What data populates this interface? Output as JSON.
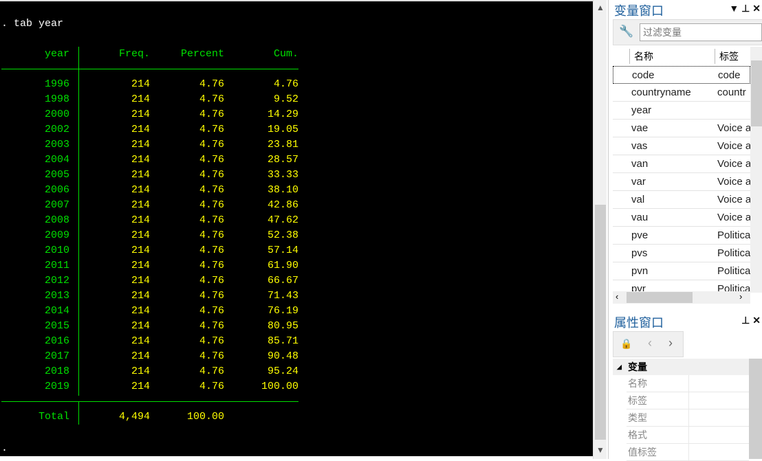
{
  "results": {
    "command": ". tab year",
    "headers": [
      "year",
      "Freq.",
      "Percent",
      "Cum."
    ],
    "rows": [
      [
        "1996",
        "214",
        "4.76",
        "4.76"
      ],
      [
        "1998",
        "214",
        "4.76",
        "9.52"
      ],
      [
        "2000",
        "214",
        "4.76",
        "14.29"
      ],
      [
        "2002",
        "214",
        "4.76",
        "19.05"
      ],
      [
        "2003",
        "214",
        "4.76",
        "23.81"
      ],
      [
        "2004",
        "214",
        "4.76",
        "28.57"
      ],
      [
        "2005",
        "214",
        "4.76",
        "33.33"
      ],
      [
        "2006",
        "214",
        "4.76",
        "38.10"
      ],
      [
        "2007",
        "214",
        "4.76",
        "42.86"
      ],
      [
        "2008",
        "214",
        "4.76",
        "47.62"
      ],
      [
        "2009",
        "214",
        "4.76",
        "52.38"
      ],
      [
        "2010",
        "214",
        "4.76",
        "57.14"
      ],
      [
        "2011",
        "214",
        "4.76",
        "61.90"
      ],
      [
        "2012",
        "214",
        "4.76",
        "66.67"
      ],
      [
        "2013",
        "214",
        "4.76",
        "71.43"
      ],
      [
        "2014",
        "214",
        "4.76",
        "76.19"
      ],
      [
        "2015",
        "214",
        "4.76",
        "80.95"
      ],
      [
        "2016",
        "214",
        "4.76",
        "85.71"
      ],
      [
        "2017",
        "214",
        "4.76",
        "90.48"
      ],
      [
        "2018",
        "214",
        "4.76",
        "95.24"
      ],
      [
        "2019",
        "214",
        "4.76",
        "100.00"
      ]
    ],
    "total": {
      "label": "Total",
      "freq": "4,494",
      "percent": "100.00"
    },
    "prompt": "."
  },
  "variables": {
    "title": "变量窗口",
    "filter_placeholder": "过滤变量",
    "col_name": "名称",
    "col_label": "标签",
    "rows": [
      {
        "name": "code",
        "label": "code"
      },
      {
        "name": "countryname",
        "label": "countr"
      },
      {
        "name": "year",
        "label": ""
      },
      {
        "name": "vae",
        "label": "Voice a"
      },
      {
        "name": "vas",
        "label": "Voice a"
      },
      {
        "name": "van",
        "label": "Voice a"
      },
      {
        "name": "var",
        "label": "Voice a"
      },
      {
        "name": "val",
        "label": "Voice a"
      },
      {
        "name": "vau",
        "label": "Voice a"
      },
      {
        "name": "pve",
        "label": "Politica"
      },
      {
        "name": "pvs",
        "label": "Politica"
      },
      {
        "name": "pvn",
        "label": "Politica"
      },
      {
        "name": "pvr",
        "label": "Politica"
      }
    ]
  },
  "properties": {
    "title": "属性窗口",
    "section": "变量",
    "fields": [
      "名称",
      "标签",
      "类型",
      "格式",
      "值标签"
    ]
  }
}
